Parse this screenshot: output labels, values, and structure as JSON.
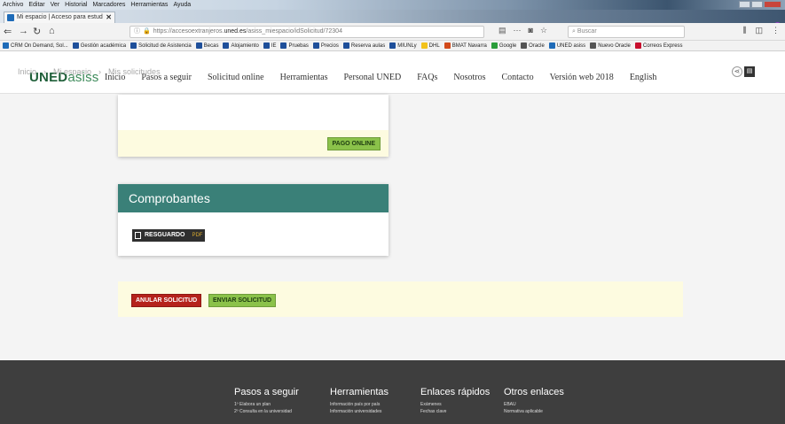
{
  "browser": {
    "menu": [
      "Archivo",
      "Editar",
      "Ver",
      "Historial",
      "Marcadores",
      "Herramientas",
      "Ayuda"
    ],
    "tab_title": "Mi espacio | Acceso para estud",
    "tab_close": "✕",
    "new_tab": "+",
    "url_prefix": "https://accesoextranjeros.",
    "url_domain": "uned.es",
    "url_path": "/asiss_miespacio/idSolicitud/72304",
    "search_placeholder": "Buscar",
    "bookmarks": [
      {
        "label": "CRM On Demand, Sol...",
        "color": "#1e6bb8"
      },
      {
        "label": "Gestión académica",
        "color": "#1e4f9a"
      },
      {
        "label": "Solicitud de Asistencia",
        "color": "#1e4f9a"
      },
      {
        "label": "Becas",
        "color": "#1e4f9a"
      },
      {
        "label": "Alojamiento",
        "color": "#1e4f9a"
      },
      {
        "label": "IE",
        "color": "#1e4f9a"
      },
      {
        "label": "Pruebas",
        "color": "#1e4f9a"
      },
      {
        "label": "Precios",
        "color": "#1e4f9a"
      },
      {
        "label": "Reserva aulas",
        "color": "#1e4f9a"
      },
      {
        "label": "MIUNLy",
        "color": "#1e4f9a"
      },
      {
        "label": "DHL",
        "color": "#f2c21b"
      },
      {
        "label": "BMAT Navarra",
        "color": "#d24a1a"
      },
      {
        "label": "Google",
        "color": "#2a9d3a"
      },
      {
        "label": "Oracle",
        "color": "#555555"
      },
      {
        "label": "UNED asiss",
        "color": "#1e6bb8"
      },
      {
        "label": "Nuevo Oracle",
        "color": "#555555"
      },
      {
        "label": "Correos Express",
        "color": "#c8102e"
      }
    ]
  },
  "site": {
    "logo_main": "UNED",
    "logo_sub": "asiss",
    "nav": [
      "Inicio",
      "Pasos a seguir",
      "Solicitud online",
      "Herramientas",
      "Personal UNED",
      "FAQs",
      "Nosotros",
      "Contacto",
      "Versión web 2018",
      "English"
    ],
    "breadcrumb": [
      "Inicio",
      "Mi espacio",
      "Mis solicitudes"
    ],
    "breadcrumb_sep": "›"
  },
  "content": {
    "pago_label": "PAGO ONLINE",
    "comprobantes_title": "Comprobantes",
    "resguardo_label": "RESGUARDO",
    "resguardo_format": "PDF",
    "anular_label": "ANULAR SOLICITUD",
    "enviar_label": "ENVIAR SOLICITUD"
  },
  "footer": {
    "columns": [
      {
        "title": "Pasos a seguir",
        "links": [
          "1º Elabora un plan",
          "2º Consulta en la universidad"
        ]
      },
      {
        "title": "Herramientas",
        "links": [
          "Información país por país",
          "Información universidades"
        ]
      },
      {
        "title": "Enlaces rápidos",
        "links": [
          "Exámenes",
          "Fechas clave"
        ]
      },
      {
        "title": "Otros enlaces",
        "links": [
          "EBAU",
          "Normativa aplicable"
        ]
      }
    ]
  },
  "colors": {
    "teal_header": "#3a8078",
    "pay_green": "#8bc24a",
    "cancel_red": "#b5221c",
    "yellow_strip": "#fdfbe0",
    "footer_bg": "#3e3e3e"
  }
}
